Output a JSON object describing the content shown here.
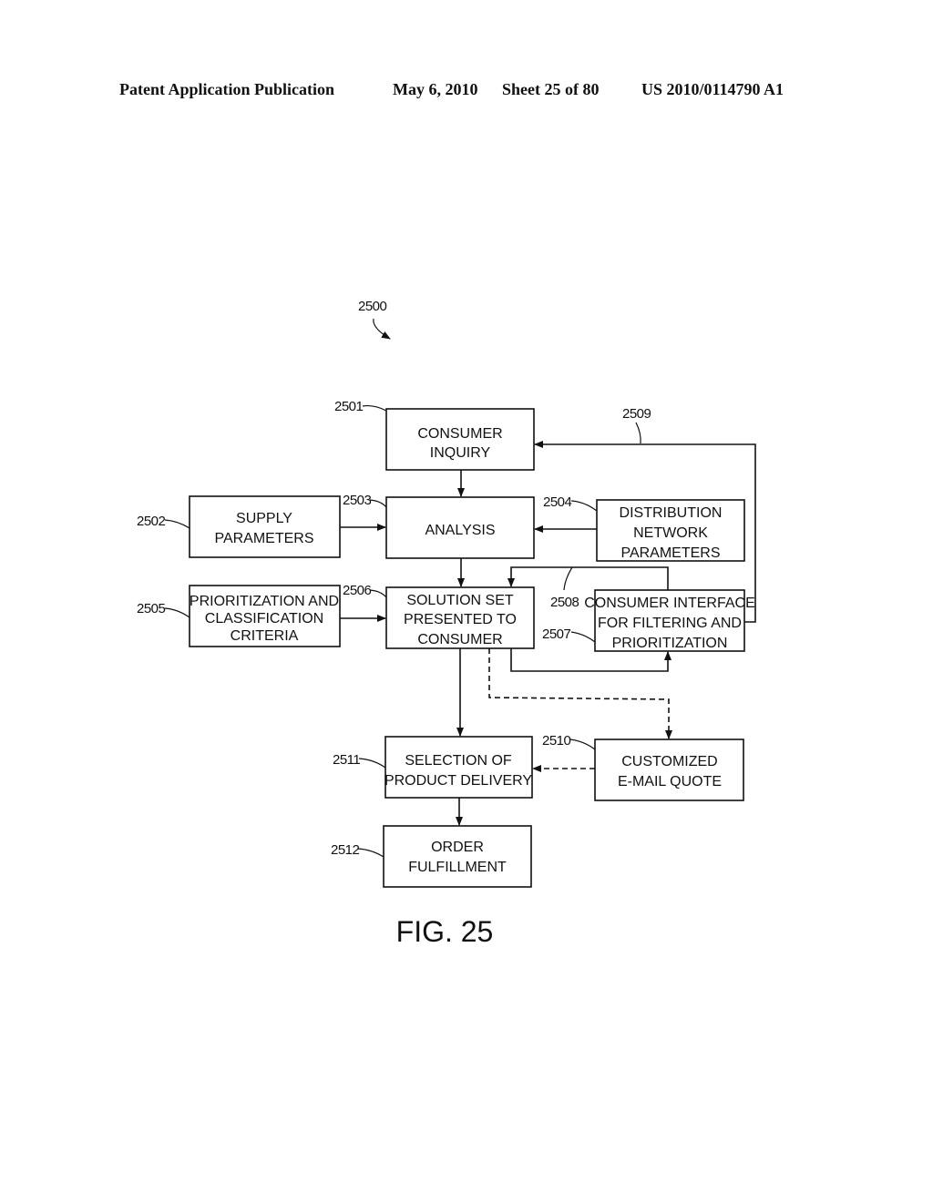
{
  "header": {
    "publication": "Patent Application Publication",
    "date": "May 6, 2010",
    "sheet": "Sheet 25 of 80",
    "number": "US 2010/0114790 A1"
  },
  "figure": {
    "ref": "2500",
    "caption": "FIG. 25"
  },
  "boxes": {
    "consumer_inquiry": {
      "ref": "2501",
      "lines": [
        "CONSUMER",
        "INQUIRY"
      ]
    },
    "supply_parameters": {
      "ref": "2502",
      "lines": [
        "SUPPLY",
        "PARAMETERS"
      ]
    },
    "analysis": {
      "ref": "2503",
      "lines": [
        "ANALYSIS"
      ]
    },
    "distribution_network": {
      "ref": "2504",
      "lines": [
        "DISTRIBUTION",
        "NETWORK",
        "PARAMETERS"
      ]
    },
    "prioritization_criteria": {
      "ref": "2505",
      "lines": [
        "PRIORITIZATION AND",
        "CLASSIFICATION",
        "CRITERIA"
      ]
    },
    "solution_set": {
      "ref": "2506",
      "lines": [
        "SOLUTION SET",
        "PRESENTED TO",
        "CONSUMER"
      ]
    },
    "consumer_interface": {
      "ref": "2507",
      "lines": [
        "CONSUMER INTERFACE",
        "FOR FILTERING AND",
        "PRIORITIZATION"
      ]
    },
    "customized_quote": {
      "ref": "2510",
      "lines": [
        "CUSTOMIZED",
        "E-MAIL QUOTE"
      ]
    },
    "selection_delivery": {
      "ref": "2511",
      "lines": [
        "SELECTION OF",
        "PRODUCT DELIVERY"
      ]
    },
    "order_fulfillment": {
      "ref": "2512",
      "lines": [
        "ORDER",
        "FULFILLMENT"
      ]
    }
  },
  "connectors": {
    "feedback_loop_ref": "2509",
    "interface_loop_ref": "2508"
  }
}
